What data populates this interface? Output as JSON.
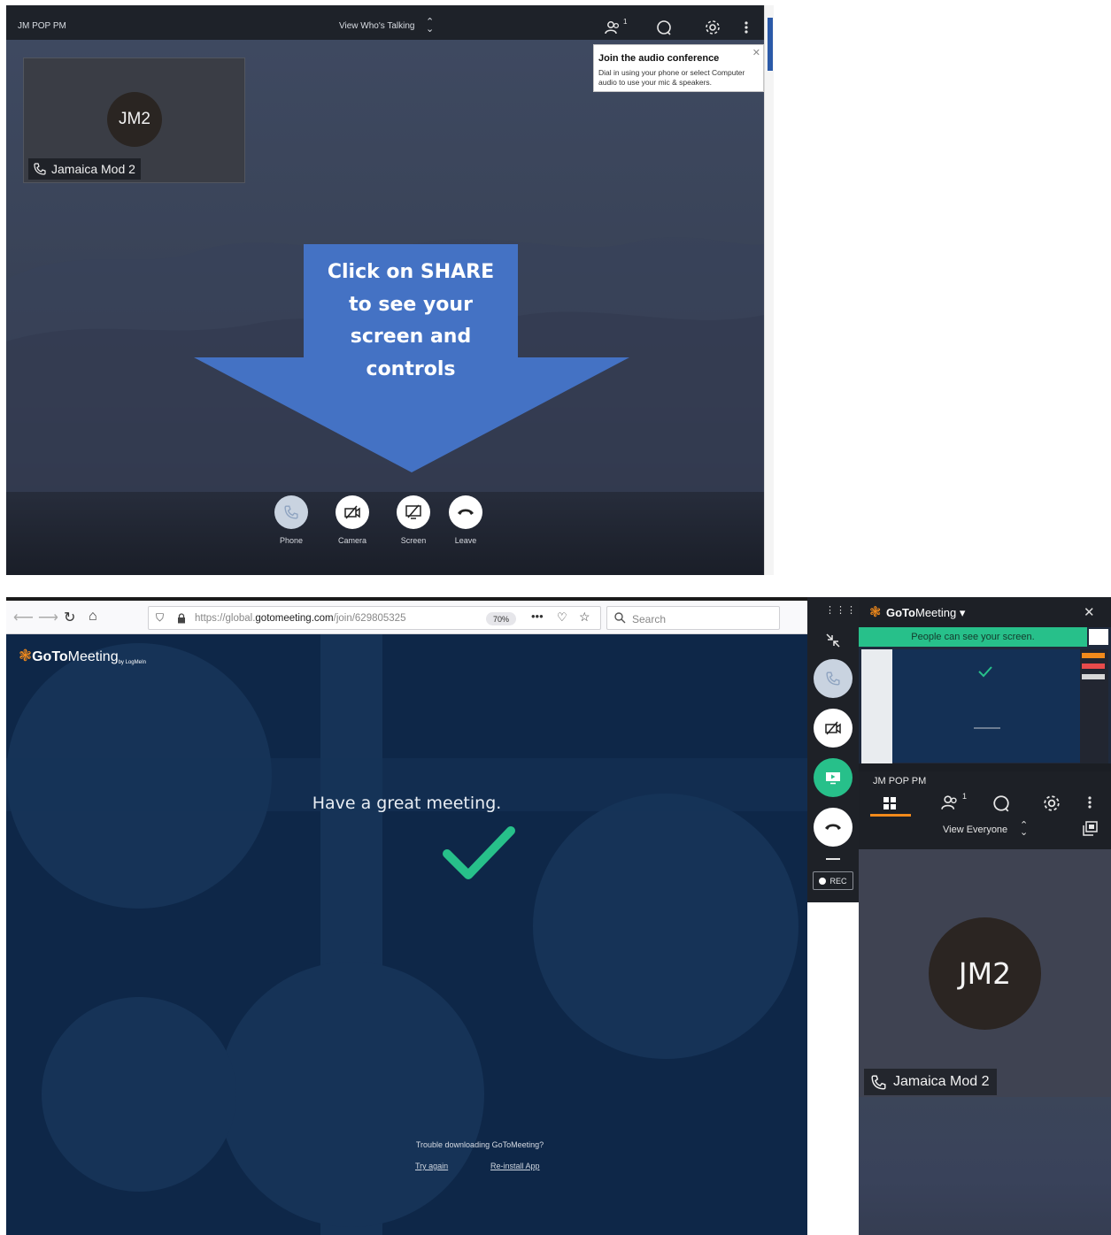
{
  "top_window": {
    "meeting_name": "JM POP PM",
    "view_selector": "View Who's Talking",
    "attendee_count": "1",
    "tooltip": {
      "title": "Join the audio conference",
      "body": "Dial in using your phone or select Computer audio to use your mic & speakers."
    },
    "tile": {
      "initials": "JM2",
      "name": "Jamaica Mod 2"
    },
    "callout_lines": [
      "Click on SHARE",
      "to see your",
      "screen and",
      "controls"
    ],
    "controls": [
      {
        "label": "Phone"
      },
      {
        "label": "Camera"
      },
      {
        "label": "Screen"
      },
      {
        "label": "Leave"
      }
    ]
  },
  "browser": {
    "url_prefix": "https://global.",
    "url_host": "gotomeeting.com",
    "url_path": "/join/629805325",
    "zoom": "70%",
    "search_placeholder": "Search",
    "logo_goto": "GoTo",
    "logo_meeting": "Meeting",
    "logo_sub": "by LogMeIn",
    "message": "Have a great meeting.",
    "trouble": "Trouble downloading GoToMeeting?",
    "try_again": "Try again",
    "reinstall": "Re-install App"
  },
  "side_strip": {
    "rec_label": "REC"
  },
  "gtm_window": {
    "brand_goto": "GoTo",
    "brand_meeting": "Meeting",
    "sharing_banner": "People can see your screen.",
    "meeting_name": "JM POP PM",
    "attendee_count": "1",
    "view_selector": "View Everyone",
    "participant": {
      "initials": "JM2",
      "name": "Jamaica Mod 2"
    }
  },
  "colors": {
    "callout_blue": "#4472c4",
    "share_green": "#27c08a",
    "accent_orange": "#f28a1b",
    "dark_navy": "#0e2748"
  }
}
